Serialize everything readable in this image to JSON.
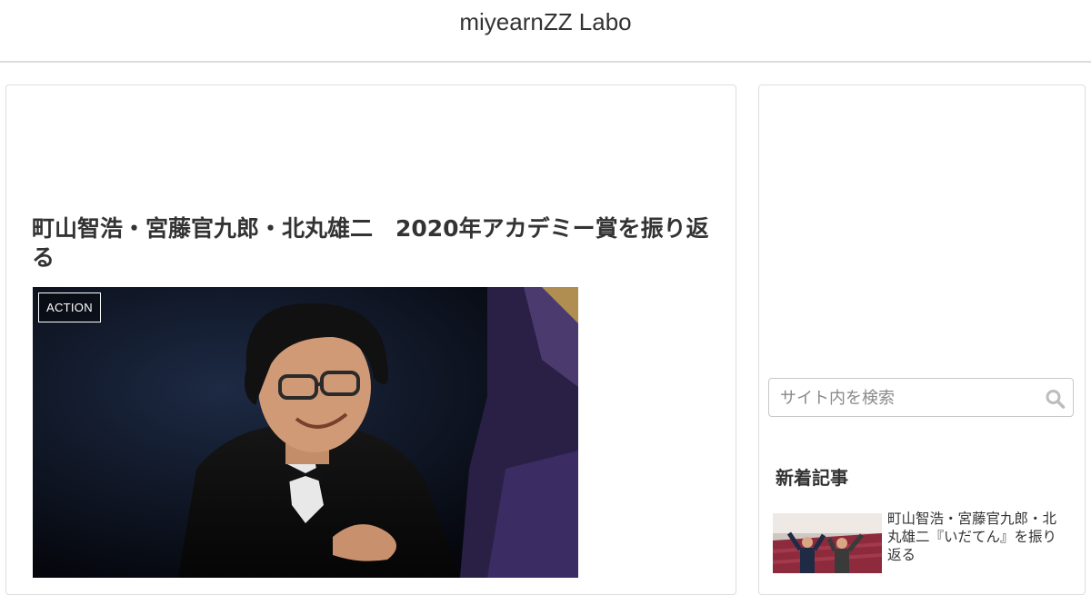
{
  "header": {
    "site_title": "miyearnZZ Labo"
  },
  "article": {
    "title": "町山智浩・宮藤官九郎・北丸雄二　2020年アカデミー賞を振り返る",
    "category_label": "ACTION"
  },
  "sidebar": {
    "search": {
      "placeholder": "サイト内を検索"
    },
    "new_entries": {
      "heading": "新着記事",
      "items": [
        {
          "title": "町山智浩・宮藤官九郎・北丸雄二『いだてん』を振り返る"
        }
      ]
    }
  },
  "colors": {
    "header_border": "#dcdcdc",
    "card_border": "#dedede",
    "text": "#333333",
    "eyecatch_bg": "#0a0f1a"
  }
}
